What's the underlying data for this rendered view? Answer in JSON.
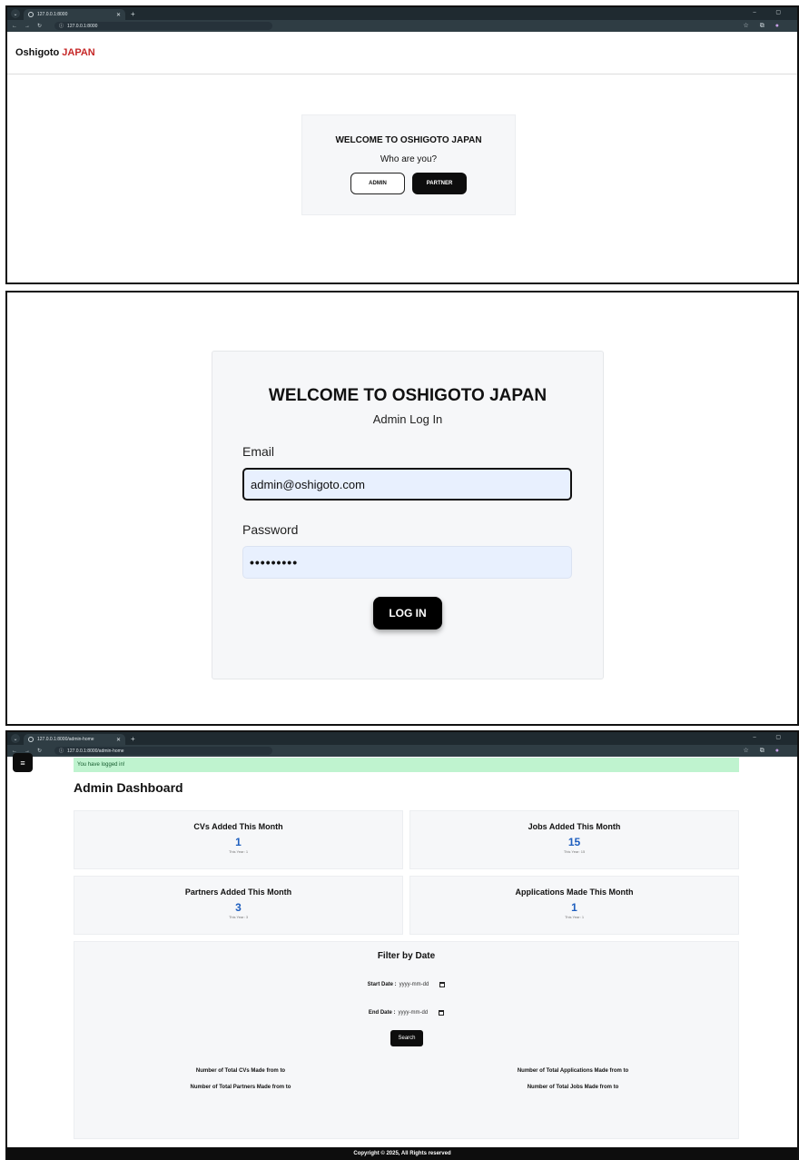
{
  "browser1": {
    "tab_title": "127.0.0.1:8000",
    "url": "127.0.0.1:8000"
  },
  "role_select": {
    "brand_primary": "Oshigoto",
    "brand_accent": "JAPAN",
    "brand_accent_color": "#c62828",
    "heading": "WELCOME TO OSHIGOTO JAPAN",
    "question": "Who are you?",
    "admin_button": "ADMIN",
    "partner_button": "PARTNER"
  },
  "login": {
    "heading": "WELCOME TO OSHIGOTO JAPAN",
    "subtitle": "Admin Log In",
    "email_label": "Email",
    "email_value": "admin@oshigoto.com",
    "password_label": "Password",
    "password_value": "•••••••••",
    "login_button": "LOG IN"
  },
  "browser3": {
    "tab_title": "127.0.0.1:8000/admin-home",
    "url": "127.0.0.1:8000/admin-home"
  },
  "dashboard": {
    "menu_icon": "≡",
    "alert": "You have logged in!",
    "title": "Admin Dashboard",
    "cards": [
      {
        "title": "CVs Added This Month",
        "value": "1",
        "sub": "This Year: 1"
      },
      {
        "title": "Jobs Added This Month",
        "value": "15",
        "sub": "This Year: 15"
      },
      {
        "title": "Partners Added This Month",
        "value": "3",
        "sub": "This Year: 3"
      },
      {
        "title": "Applications Made This Month",
        "value": "1",
        "sub": "This Year: 1"
      }
    ],
    "accent_color": "#1f5fbf",
    "filter": {
      "title": "Filter by Date",
      "start_label": "Start Date :",
      "start_placeholder": "yyyy-mm-dd",
      "end_label": "End Date :",
      "end_placeholder": "yyyy-mm-dd",
      "search_button": "Search",
      "total_cvs": "Number of Total CVs Made from to",
      "total_applications": "Number of Total Applications Made from to",
      "total_partners": "Number of Total Partners Made from to",
      "total_jobs": "Number of Total Jobs Made from to"
    },
    "footer": "Copyright © 2025, All Rights reserved"
  }
}
